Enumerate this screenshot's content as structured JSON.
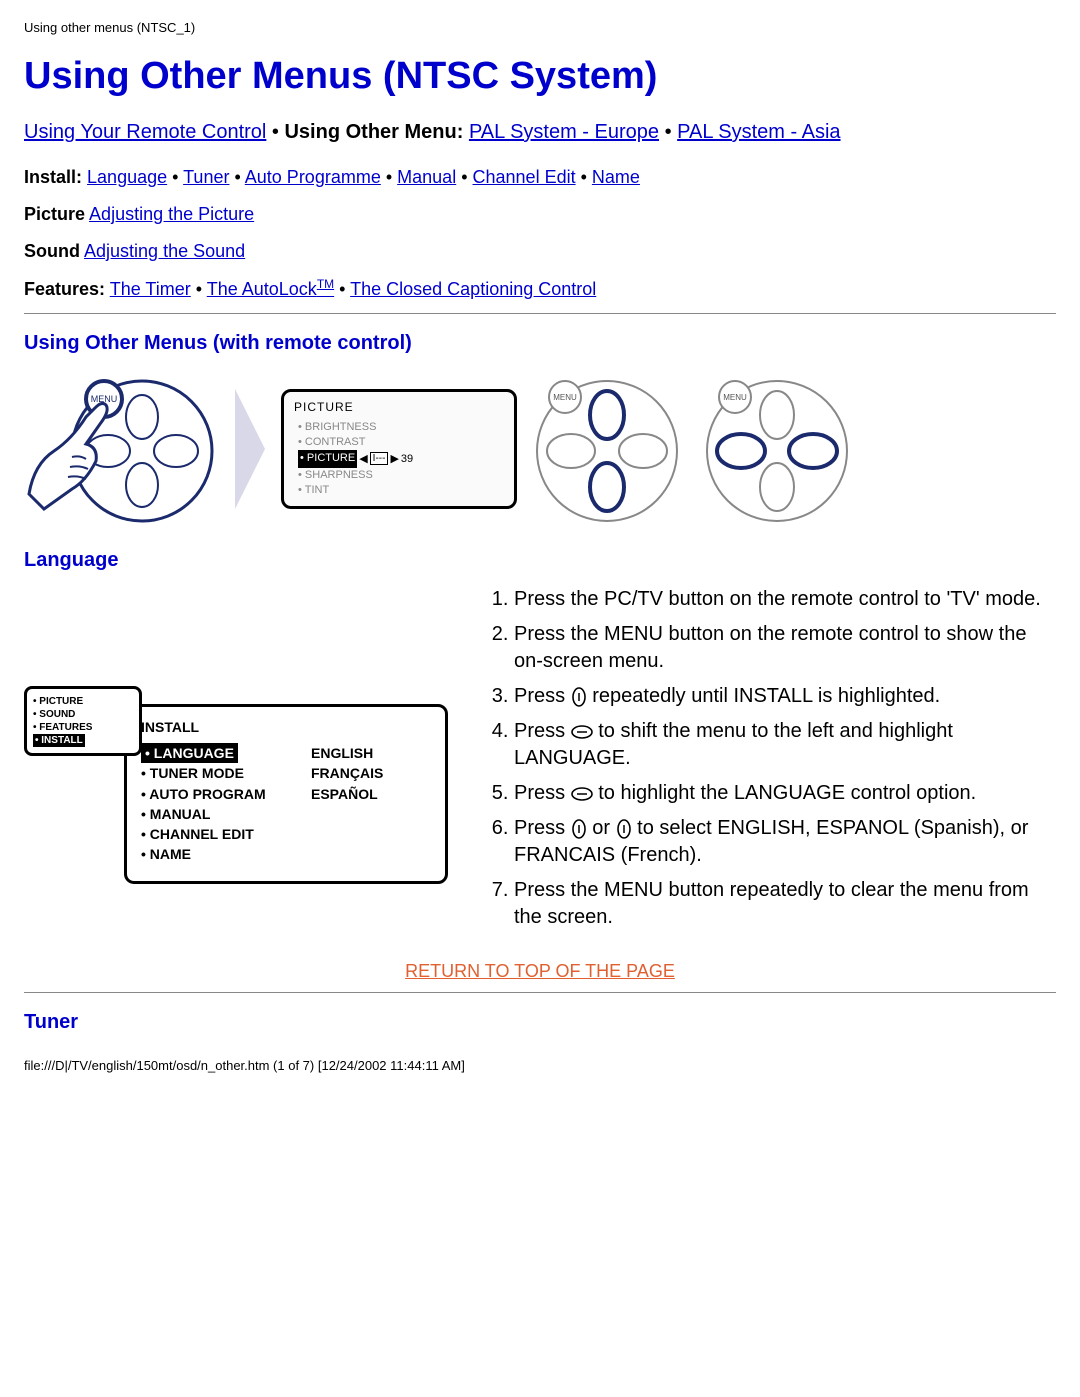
{
  "header_path": "Using other menus (NTSC_1)",
  "page_title": "Using Other Menus (NTSC System)",
  "nav": {
    "remote_link": "Using Your Remote Control",
    "other_menu_label": "Using Other Menu:",
    "pal_europe": "PAL System - Europe",
    "pal_asia": "PAL System - Asia"
  },
  "install": {
    "label": "Install:",
    "language": "Language",
    "tuner": "Tuner",
    "auto_programme": "Auto Programme",
    "manual": "Manual",
    "channel_edit": "Channel Edit",
    "name": "Name"
  },
  "picture": {
    "label": "Picture",
    "link": "Adjusting the Picture"
  },
  "sound": {
    "label": "Sound",
    "link": "Adjusting the Sound"
  },
  "features": {
    "label": "Features:",
    "timer": "The Timer",
    "autolock": "The AutoLock",
    "tm": "TM",
    "cc": "The Closed Captioning Control"
  },
  "section_remote_heading": "Using Other Menus (with remote control)",
  "osd_picture": {
    "title": "PICTURE",
    "items": [
      "BRIGHTNESS",
      "CONTRAST",
      "PICTURE",
      "SHARPNESS",
      "TINT"
    ],
    "selected_index": 2,
    "value_prefix": "I---",
    "value": "39"
  },
  "menu_badge": "MENU",
  "section_language_heading": "Language",
  "menucard": {
    "small": {
      "items": [
        "PICTURE",
        "SOUND",
        "FEATURES",
        "INSTALL"
      ],
      "selected_index": 3
    },
    "big": {
      "title": "INSTALL",
      "left": [
        "LANGUAGE",
        "TUNER MODE",
        "AUTO PROGRAM",
        "MANUAL",
        "CHANNEL EDIT",
        "NAME"
      ],
      "left_selected_index": 0,
      "right": [
        "ENGLISH",
        "FRANÇAIS",
        "ESPAÑOL"
      ]
    }
  },
  "steps": {
    "s1": "Press the PC/TV button on the remote control to 'TV' mode.",
    "s2": "Press the MENU button on the remote control to show the on-screen menu.",
    "s3a": "Press ",
    "s3b": " repeatedly until INSTALL is highlighted.",
    "s4a": "Press ",
    "s4b": " to shift the menu to the left and highlight LANGUAGE.",
    "s5a": "Press ",
    "s5b": " to highlight the LANGUAGE control option.",
    "s6a": "Press ",
    "s6b": " or ",
    "s6c": " to select ENGLISH, ESPANOL (Spanish), or FRANCAIS (French).",
    "s7": "Press the MENU button repeatedly to clear the menu from the screen."
  },
  "return_link": "RETURN TO TOP OF THE PAGE",
  "section_tuner_heading": "Tuner",
  "footer_path": "file:///D|/TV/english/150mt/osd/n_other.htm (1 of 7) [12/24/2002 11:44:11 AM]"
}
